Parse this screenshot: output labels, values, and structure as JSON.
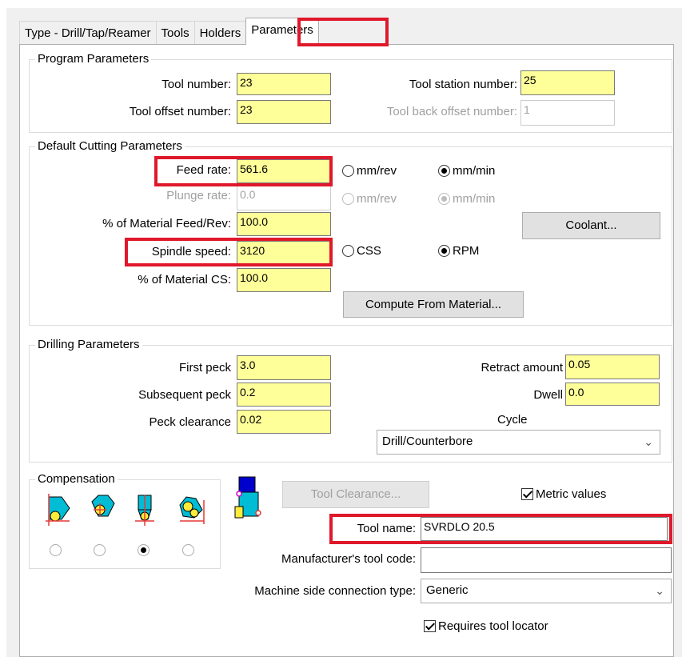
{
  "tabs": [
    "Type - Drill/Tap/Reamer",
    "Tools",
    "Holders",
    "Parameters"
  ],
  "program": {
    "title": "Program Parameters",
    "tool_number_label": "Tool number:",
    "tool_number": "23",
    "tool_station_label": "Tool station number:",
    "tool_station": "25",
    "tool_offset_label": "Tool offset number:",
    "tool_offset": "23",
    "tool_back_offset_label": "Tool back offset number:",
    "tool_back_offset": "1"
  },
  "cutting": {
    "title": "Default Cutting Parameters",
    "feed_rate_label": "Feed rate:",
    "feed_rate": "561.6",
    "plunge_rate_label": "Plunge rate:",
    "plunge_rate": "0.0",
    "mat_feed_label": "% of Material Feed/Rev:",
    "mat_feed": "100.0",
    "spindle_label": "Spindle speed:",
    "spindle": "3120",
    "mat_cs_label": "% of Material CS:",
    "mat_cs": "100.0",
    "mm_rev": "mm/rev",
    "mm_min": "mm/min",
    "css": "CSS",
    "rpm": "RPM",
    "coolant": "Coolant...",
    "compute": "Compute From Material..."
  },
  "drilling": {
    "title": "Drilling Parameters",
    "first_peck_label": "First peck",
    "first_peck": "3.0",
    "subsequent_label": "Subsequent peck",
    "subsequent": "0.2",
    "clearance_label": "Peck clearance",
    "clearance": "0.02",
    "retract_label": "Retract amount",
    "retract": "0.05",
    "dwell_label": "Dwell",
    "dwell": "0.0",
    "cycle_label": "Cycle",
    "cycle": "Drill/Counterbore"
  },
  "compensation": {
    "title": "Compensation"
  },
  "bottom": {
    "tool_clearance": "Tool Clearance...",
    "metric": "Metric values",
    "tool_name_label": "Tool name:",
    "tool_name": "SVRDLO 20.5",
    "mfr_label": "Manufacturer's tool code:",
    "mfr": "",
    "machine_label": "Machine side connection type:",
    "machine": "Generic",
    "locator": "Requires tool locator"
  },
  "colors": {
    "field_yellow": "#ffff99",
    "highlight_red": "#e0182b",
    "icon_cyan": "#00bcd4"
  }
}
